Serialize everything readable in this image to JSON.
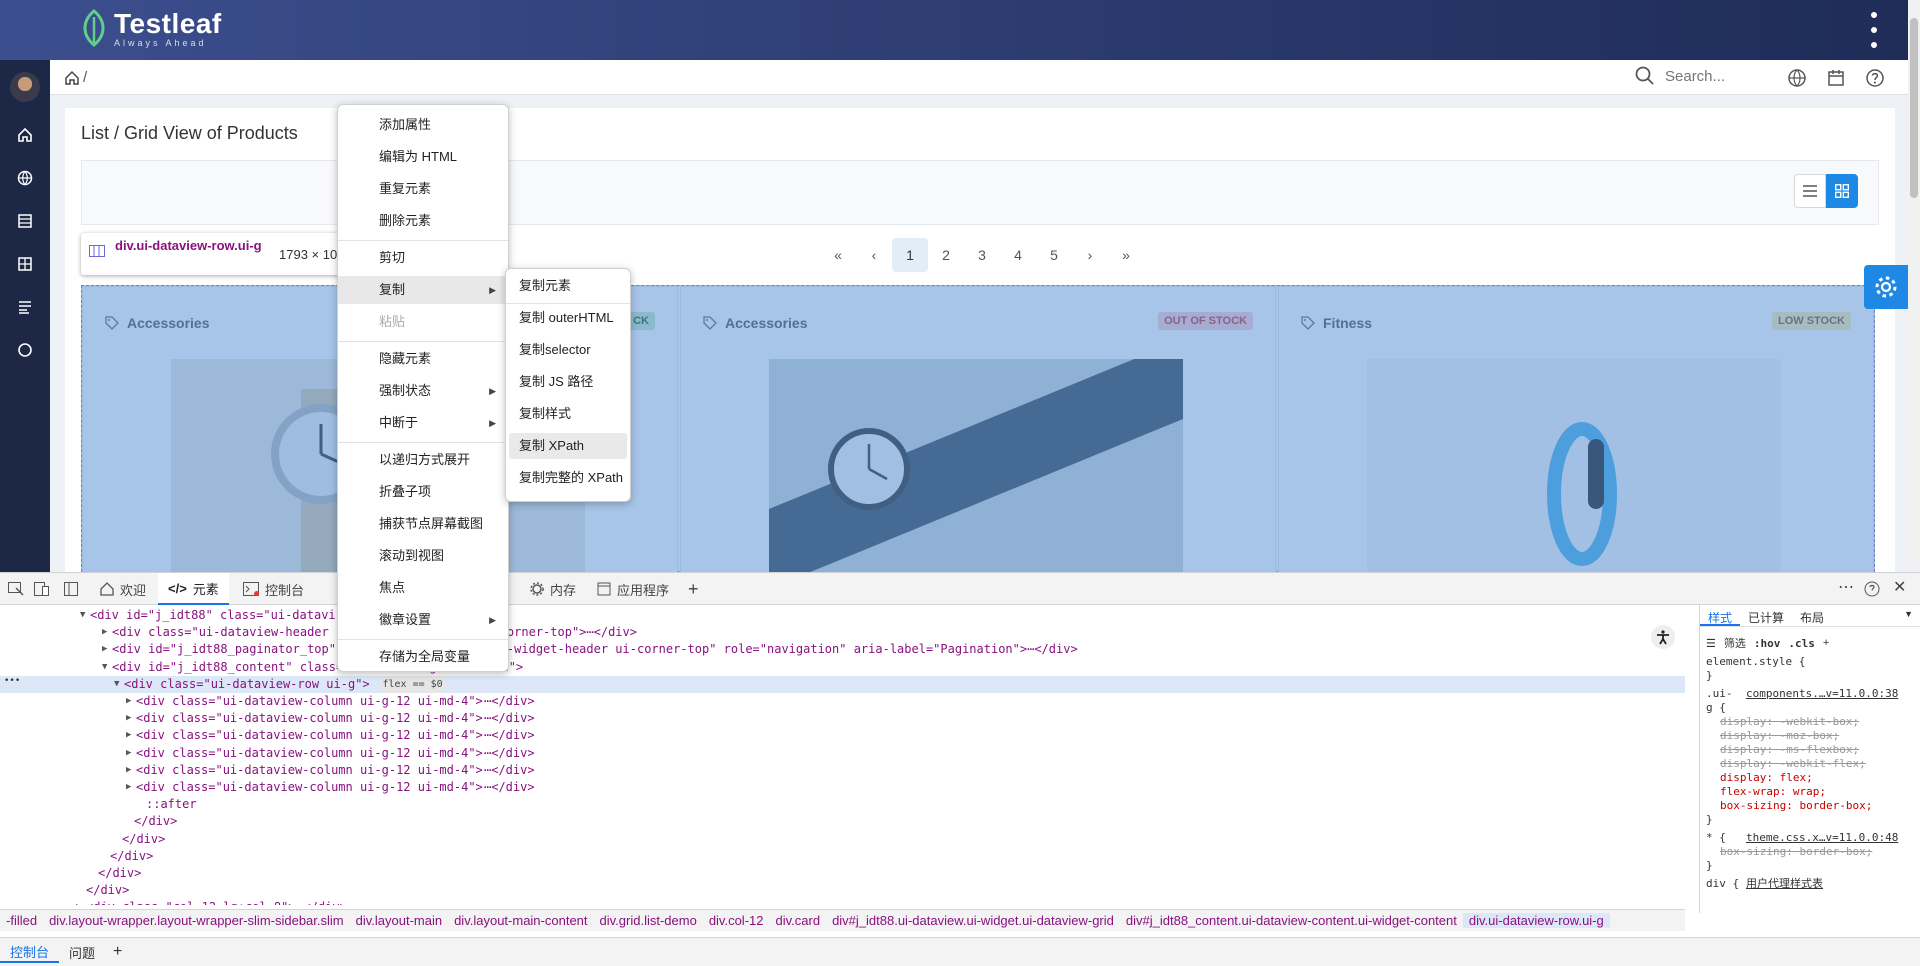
{
  "app": {
    "name": "Testleaf",
    "tagline": "Always Ahead"
  },
  "header": {
    "search_placeholder": "Search...",
    "breadcrumb": "/"
  },
  "card": {
    "title": "List / Grid View of Products"
  },
  "paginator": {
    "first": "«",
    "prev": "‹",
    "pages": [
      "1",
      "2",
      "3",
      "4",
      "5"
    ],
    "active_page": "1",
    "next": "›",
    "last": "»"
  },
  "tooltip": {
    "selector": "div.ui-dataview-row.ui-g",
    "dimensions": "1793 × 10"
  },
  "products": [
    {
      "category": "Accessories",
      "badge": "CK",
      "badge_color": "#c8e6c9"
    },
    {
      "category": "Accessories",
      "badge": "OUT OF STOCK",
      "badge_color": "#ffcdd2"
    },
    {
      "category": "Fitness",
      "badge": "LOW STOCK",
      "badge_color": "#feedaf"
    }
  ],
  "devtools": {
    "tabs": [
      {
        "label": "欢迎",
        "icon": "home-icon"
      },
      {
        "label": "元素",
        "icon": "code-icon"
      },
      {
        "label": "控制台",
        "icon": "console-icon"
      },
      {
        "label": "内存",
        "icon": "memory-icon"
      },
      {
        "label": "应用程序",
        "icon": "app-icon"
      }
    ],
    "add_tab": "+",
    "code_lines": [
      {
        "indent": 90,
        "arrow": "▼",
        "html": "<div id=\"j_idt88\" class=\"ui-datavi",
        "rest": "rid\">",
        "sel": false
      },
      {
        "indent": 112,
        "arrow": "▶",
        "html": "<div class=\"ui-dataview-header u",
        "rest": "clearfix ui-corner-top\">⋯</div>",
        "sel": false
      },
      {
        "indent": 112,
        "arrow": "▶",
        "html": "<div id=\"j_idt88_paginator_top\"",
        "rest": "inator-top ui-widget-header ui-corner-top\" role=\"navigation\" aria-label=\"Pagination\">⋯</div>",
        "sel": false
      },
      {
        "indent": 112,
        "arrow": "▼",
        "html": "<div id=\"j_idt88_content\" class=",
        "rest": "dget-content\">",
        "sel": false
      },
      {
        "indent": 124,
        "arrow": "▼",
        "html": "<div class=\"ui-dataview-row ui-g\">",
        "rest": "flex == $0",
        "sel": true
      },
      {
        "indent": 136,
        "arrow": "▶",
        "html": "<div class=\"ui-dataview-column ui-g-12 ui-md-4\">",
        "rest": "⋯</div>",
        "sel": false
      },
      {
        "indent": 136,
        "arrow": "▶",
        "html": "<div class=\"ui-dataview-column ui-g-12 ui-md-4\">",
        "rest": "⋯</div>",
        "sel": false
      },
      {
        "indent": 136,
        "arrow": "▶",
        "html": "<div class=\"ui-dataview-column ui-g-12 ui-md-4\">",
        "rest": "⋯</div>",
        "sel": false
      },
      {
        "indent": 136,
        "arrow": "▶",
        "html": "<div class=\"ui-dataview-column ui-g-12 ui-md-4\">",
        "rest": "⋯</div>",
        "sel": false
      },
      {
        "indent": 136,
        "arrow": "▶",
        "html": "<div class=\"ui-dataview-column ui-g-12 ui-md-4\">",
        "rest": "⋯</div>",
        "sel": false
      },
      {
        "indent": 136,
        "arrow": "▶",
        "html": "<div class=\"ui-dataview-column ui-g-12 ui-md-4\">",
        "rest": "⋯</div>",
        "sel": false
      },
      {
        "indent": 146,
        "arrow": "",
        "html": "::after",
        "rest": "",
        "sel": false
      },
      {
        "indent": 134,
        "arrow": "",
        "html": "</div>",
        "rest": "",
        "sel": false
      },
      {
        "indent": 122,
        "arrow": "",
        "html": "</div>",
        "rest": "",
        "sel": false
      },
      {
        "indent": 110,
        "arrow": "",
        "html": "</div>",
        "rest": "",
        "sel": false
      },
      {
        "indent": 98,
        "arrow": "",
        "html": "</div>",
        "rest": "",
        "sel": false
      },
      {
        "indent": 86,
        "arrow": "",
        "html": "</div>",
        "rest": "",
        "sel": false
      },
      {
        "indent": 86,
        "arrow": "▶",
        "html": "<div class=\"col-12 lg:col-8\">",
        "rest": "⋯</div>",
        "sel": false
      }
    ],
    "styles_tabs": [
      "样式",
      "已计算",
      "布局"
    ],
    "filter": "筛选",
    "hov": ":hov",
    "cls": ".cls",
    "styles": [
      {
        "text": "element.style {",
        "type": "sel"
      },
      {
        "text": "}",
        "type": "sel"
      },
      {
        "text": ".ui-",
        "type": "sel"
      },
      {
        "text": "components.…v=11.0.0:38",
        "type": "src"
      },
      {
        "text": "g {",
        "type": "sel"
      },
      {
        "text": "display: -webkit-box;",
        "type": "strike"
      },
      {
        "text": "display: -moz-box;",
        "type": "strike"
      },
      {
        "text": "display: -ms-flexbox;",
        "type": "strike"
      },
      {
        "text": "display: -webkit-flex;",
        "type": "strike"
      },
      {
        "text": "display: flex;",
        "type": "prop"
      },
      {
        "text": "flex-wrap: wrap;",
        "type": "prop"
      },
      {
        "text": "box-sizing: border-box;",
        "type": "prop"
      },
      {
        "text": "}",
        "type": "sel"
      },
      {
        "text": "* {",
        "type": "sel"
      },
      {
        "text": "theme.css.x…v=11.0.0:48",
        "type": "src"
      },
      {
        "text": "box-sizing: border-box;",
        "type": "strike"
      },
      {
        "text": "}",
        "type": "sel"
      },
      {
        "text": "div {",
        "type": "sel"
      },
      {
        "text": "用户代理样式表",
        "type": "src"
      }
    ],
    "breadcrumbs": [
      "-filled",
      "div.layout-wrapper.layout-wrapper-slim-sidebar.slim",
      "div.layout-main",
      "div.layout-main-content",
      "div.grid.list-demo",
      "div.col-12",
      "div.card",
      "div#j_idt88.ui-dataview.ui-widget.ui-dataview-grid",
      "div#j_idt88_content.ui-dataview-content.ui-widget-content",
      "div.ui-dataview-row.ui-g"
    ],
    "drawer_tabs": [
      "控制台",
      "问题"
    ]
  },
  "context_menu": {
    "items": [
      {
        "label": "添加属性",
        "sub": false,
        "disabled": false
      },
      {
        "label": "编辑为 HTML",
        "sub": false,
        "disabled": false
      },
      {
        "label": "重复元素",
        "sub": false,
        "disabled": false
      },
      {
        "label": "删除元素",
        "sub": false,
        "disabled": false
      },
      {
        "label": "剪切",
        "sub": false,
        "disabled": false
      },
      {
        "label": "复制",
        "sub": true,
        "disabled": false
      },
      {
        "label": "粘贴",
        "sub": false,
        "disabled": true
      },
      {
        "label": "隐藏元素",
        "sub": false,
        "disabled": false
      },
      {
        "label": "强制状态",
        "sub": true,
        "disabled": false
      },
      {
        "label": "中断于",
        "sub": true,
        "disabled": false
      },
      {
        "label": "以递归方式展开",
        "sub": false,
        "disabled": false
      },
      {
        "label": "折叠子项",
        "sub": false,
        "disabled": false
      },
      {
        "label": "捕获节点屏幕截图",
        "sub": false,
        "disabled": false
      },
      {
        "label": "滚动到视图",
        "sub": false,
        "disabled": false
      },
      {
        "label": "焦点",
        "sub": false,
        "disabled": false
      },
      {
        "label": "徽章设置",
        "sub": true,
        "disabled": false
      },
      {
        "label": "存储为全局变量",
        "sub": false,
        "disabled": false
      }
    ],
    "submenu": [
      "复制元素",
      "复制 outerHTML",
      "复制selector",
      "复制 JS 路径",
      "复制样式",
      "复制 XPath",
      "复制完整的 XPath"
    ],
    "highlighted_submenu": "复制 XPath"
  }
}
